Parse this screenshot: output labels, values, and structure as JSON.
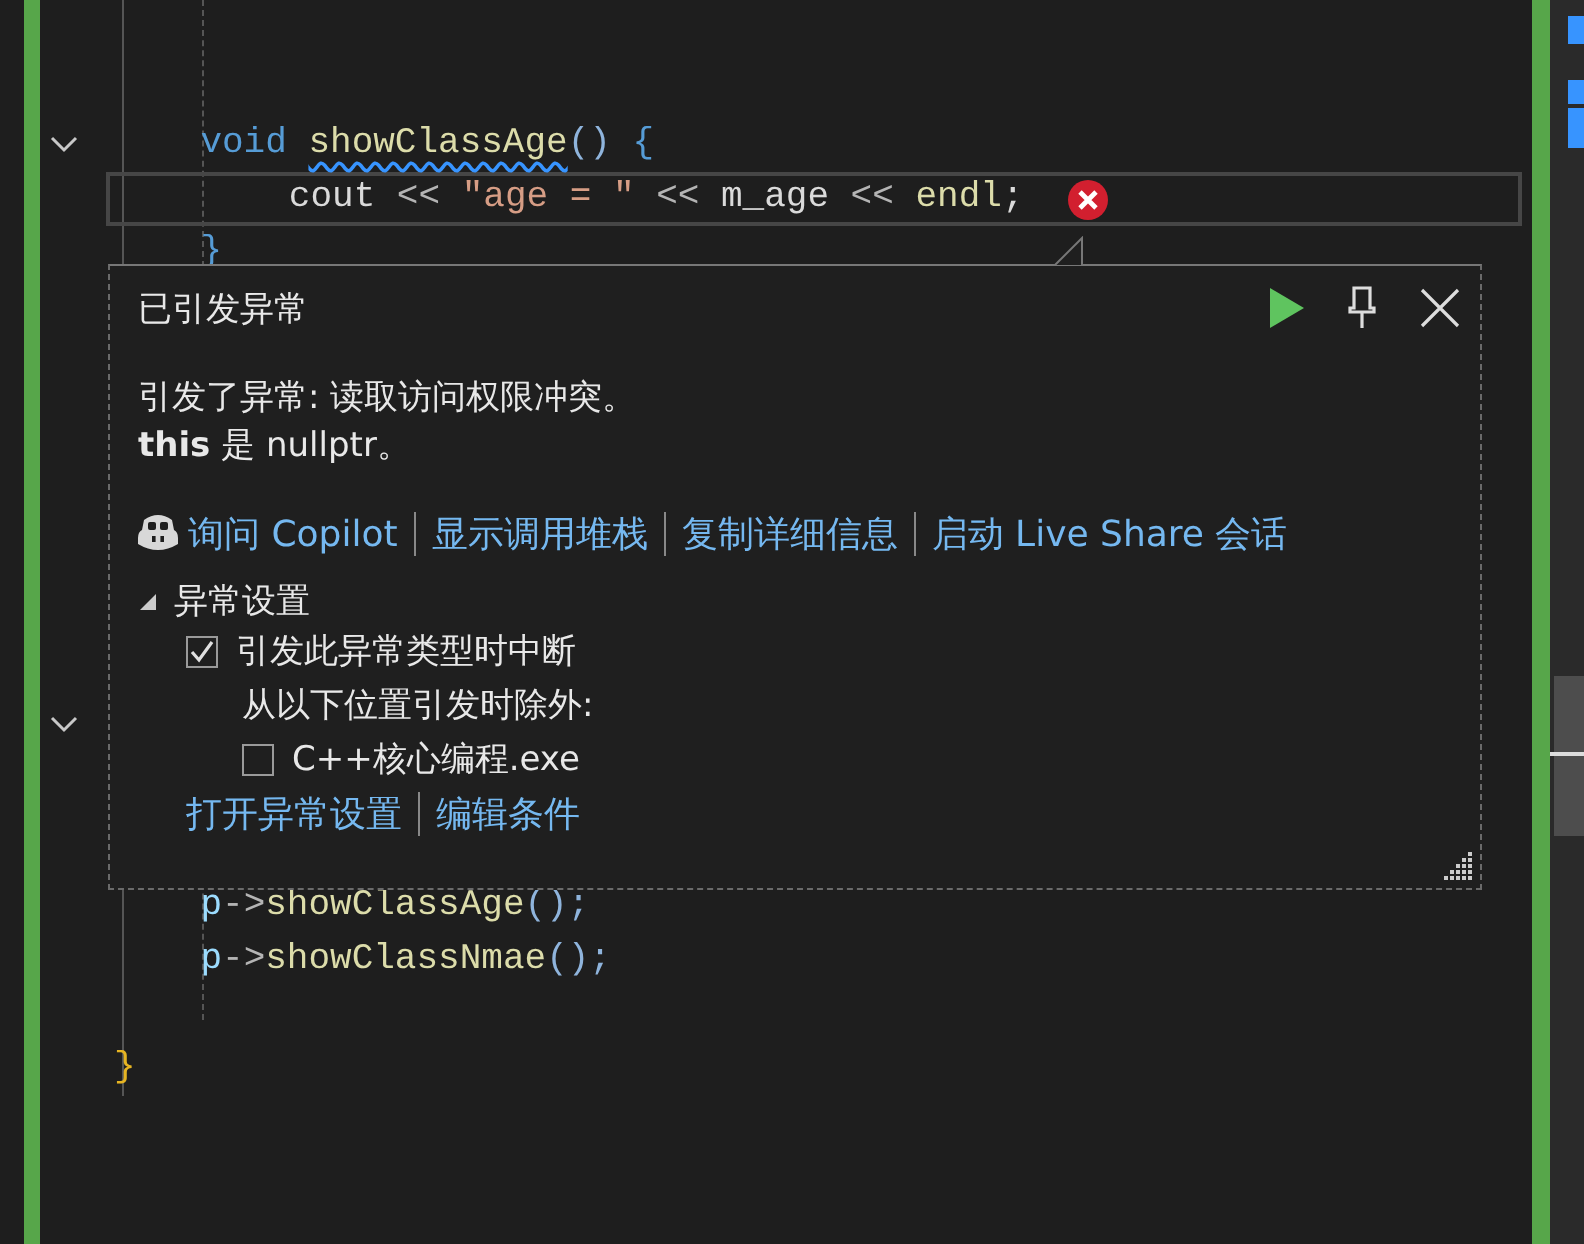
{
  "editor": {
    "code_top": [
      {
        "current": false,
        "error": false,
        "tokens": [
          {
            "text": "    void ",
            "kind": "kw"
          },
          {
            "text": "showClassAge",
            "kind": "fn-squiggle"
          },
          {
            "text": "()",
            "kind": "paren"
          },
          {
            "text": " {",
            "kind": "brace"
          }
        ]
      },
      {
        "current": true,
        "error": true,
        "tokens": [
          {
            "text": "        cout",
            "kind": "plain"
          },
          {
            "text": " << ",
            "kind": "op"
          },
          {
            "text": "\"age = \"",
            "kind": "str"
          },
          {
            "text": " << ",
            "kind": "op"
          },
          {
            "text": "m_age",
            "kind": "plain"
          },
          {
            "text": " << ",
            "kind": "op"
          },
          {
            "text": "endl",
            "kind": "fn"
          },
          {
            "text": ";",
            "kind": "plain"
          }
        ]
      },
      {
        "current": false,
        "error": false,
        "tokens": [
          {
            "text": "    }",
            "kind": "brace"
          }
        ]
      }
    ],
    "code_bottom": [
      {
        "current": false,
        "error": false,
        "tokens": [
          {
            "text": "    p",
            "kind": "var"
          },
          {
            "text": "->",
            "kind": "op"
          },
          {
            "text": "showClassAge",
            "kind": "fn"
          },
          {
            "text": "();",
            "kind": "paren"
          }
        ]
      },
      {
        "current": false,
        "error": false,
        "tokens": [
          {
            "text": "    p",
            "kind": "var"
          },
          {
            "text": "->",
            "kind": "op"
          },
          {
            "text": "showClassNmae",
            "kind": "fn"
          },
          {
            "text": "();",
            "kind": "paren"
          }
        ]
      }
    ],
    "code_end": [
      {
        "current": false,
        "error": false,
        "tokens": [
          {
            "text": "}",
            "kind": "brace2"
          }
        ]
      }
    ]
  },
  "exception_popup": {
    "title": "已引发异常",
    "message": "引发了异常: 读取访问权限冲突。",
    "detail": "**this** 是 nullptr。",
    "links": [
      "询问 Copilot",
      "显示调用堆栈",
      "复制详细信息",
      "启动 Live Share 会话"
    ],
    "settings": {
      "title": "异常设置",
      "expanded": true,
      "break_option": {
        "label": "引发此异常类型时中断",
        "checked": true
      },
      "except_label": "从以下位置引发时除外:",
      "modules": [
        {
          "label": "C++核心编程.exe",
          "checked": false
        }
      ]
    },
    "footer_links": [
      "打开异常设置",
      "编辑条件"
    ]
  }
}
